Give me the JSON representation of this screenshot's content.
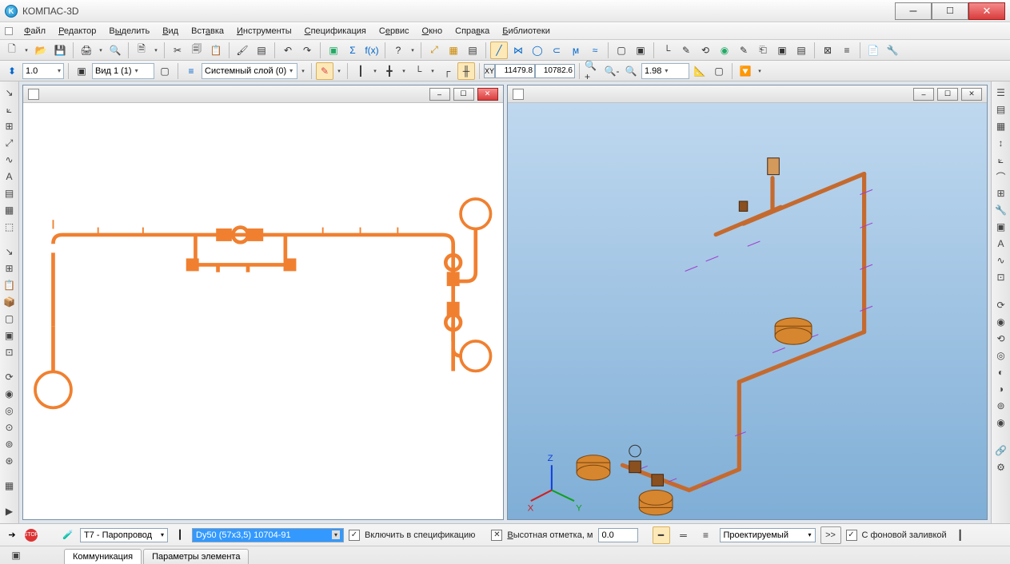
{
  "title": "КОМПАС-3D",
  "menu": {
    "file": "Файл",
    "editor": "Редактор",
    "select": "Выделить",
    "view": "Вид",
    "insert": "Вставка",
    "tools": "Инструменты",
    "spec": "Спецификация",
    "service": "Сервис",
    "window": "Окно",
    "help": "Справка",
    "libs": "Библиотеки"
  },
  "toolbar2": {
    "scale": "1.0",
    "view": "Вид 1 (1)",
    "layer": "Системный слой (0)",
    "x": "11479.8",
    "y": "10782.6",
    "zoom": "1.98"
  },
  "bottom": {
    "pipeline": "T7 - Паропровод",
    "spec_sel": "Dy50 (57x3,5) 10704-91",
    "include": "Включить в спецификацию",
    "elev_label": "Высотная отметка, м",
    "elev": "0.0",
    "status": "Проектируемый",
    "morebtn": ">>",
    "bgfill": "С фоновой заливкой",
    "tab1": "Коммуникация",
    "tab2": "Параметры элемента"
  },
  "colors": {
    "accent": "#0e83c7",
    "pipe": "#f08030",
    "pipe3d": "#c56a2e"
  }
}
